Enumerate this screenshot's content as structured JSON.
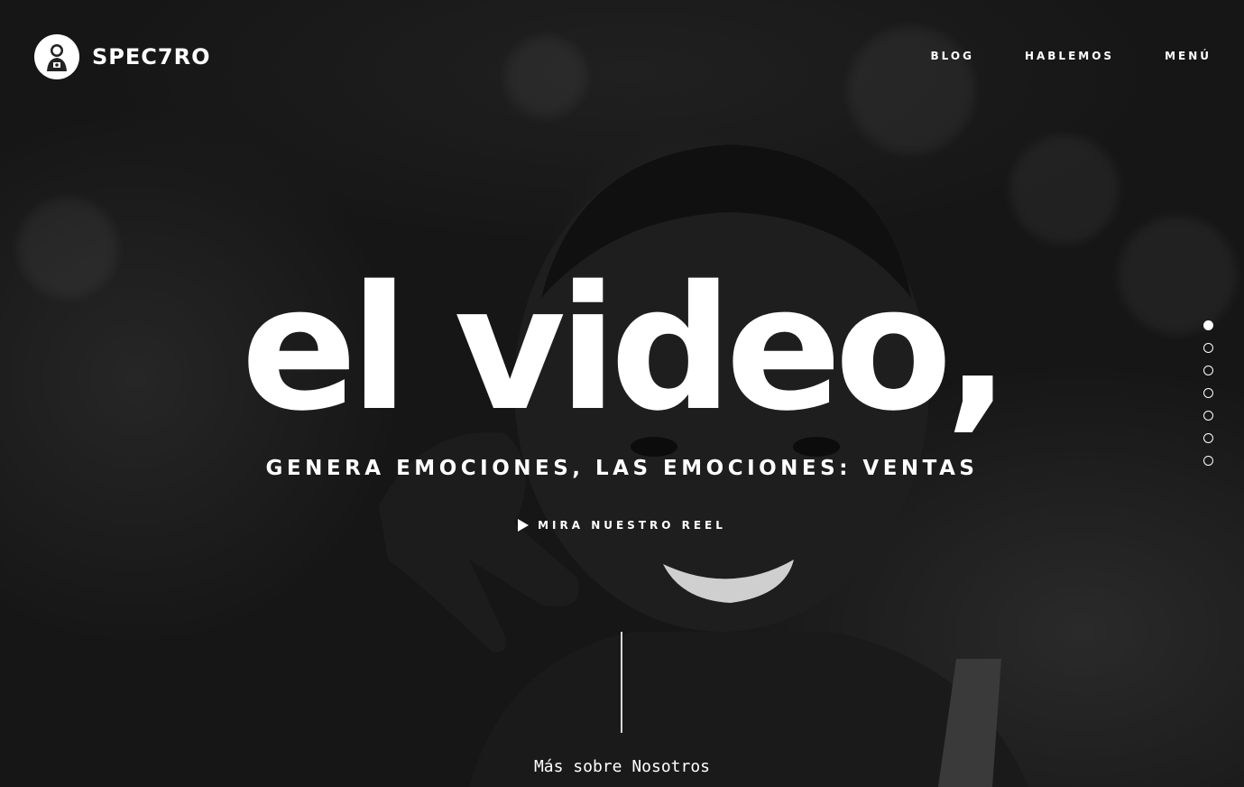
{
  "brand": {
    "name": "SPEC7RO",
    "logo_icon": "astronaut-icon"
  },
  "nav": {
    "items": [
      {
        "label": "BLOG"
      },
      {
        "label": "HABLEMOS"
      },
      {
        "label": "MENÚ"
      }
    ]
  },
  "hero": {
    "headline": "el video,",
    "tagline": "GENERA EMOCIONES, LAS EMOCIONES: VENTAS",
    "reel_label": "MIRA NUESTRO REEL",
    "reel_icon": "play-icon",
    "more_label": "Más sobre Nosotros"
  },
  "pagination": {
    "count": 7,
    "active_index": 0
  },
  "colors": {
    "text": "#ffffff",
    "background": "#161616"
  }
}
